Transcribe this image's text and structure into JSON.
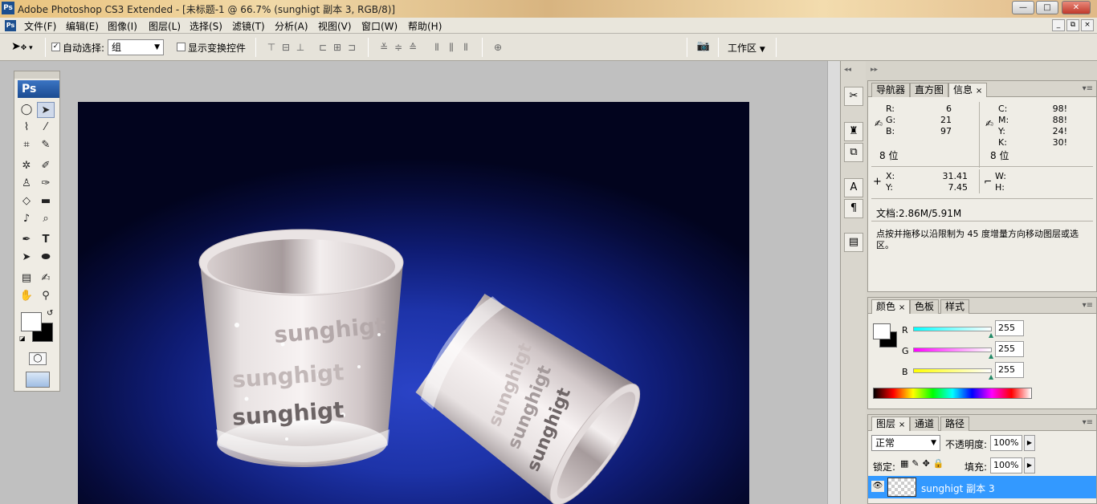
{
  "window": {
    "icon": "Ps",
    "title": "Adobe Photoshop CS3 Extended - [未标题-1 @ 66.7% (sunghigt 副本 3, RGB/8)]",
    "controls": {
      "minimize": "—",
      "maximize": "□",
      "close": "✕"
    }
  },
  "menubar": {
    "icon": "Ps",
    "items": [
      "文件(F)",
      "编辑(E)",
      "图像(I)",
      "图层(L)",
      "选择(S)",
      "滤镜(T)",
      "分析(A)",
      "视图(V)",
      "窗口(W)",
      "帮助(H)"
    ],
    "doc_controls": {
      "minimize": "_",
      "restore": "⧉",
      "close": "×"
    }
  },
  "options": {
    "auto_select_label": "自动选择:",
    "auto_select_checked": true,
    "auto_select_value": "组",
    "show_transform_label": "显示变换控件",
    "show_transform_checked": false,
    "workspace_label": "工作区",
    "align_icons": [
      "align-top-icon",
      "align-vcenter-icon",
      "align-bottom-icon",
      "align-left-icon",
      "align-hcenter-icon",
      "align-right-icon",
      "distribute-top-icon",
      "distribute-vcenter-icon",
      "distribute-bottom-icon",
      "distribute-left-icon",
      "distribute-hcenter-icon",
      "distribute-right-icon",
      "auto-align-icon"
    ]
  },
  "toolbox": {
    "logo": "Ps",
    "tools": [
      "marquee-tool",
      "move-tool",
      "lasso-tool",
      "magic-wand-tool",
      "crop-tool",
      "slice-tool",
      "healing-brush-tool",
      "brush-tool",
      "clone-stamp-tool",
      "history-brush-tool",
      "eraser-tool",
      "gradient-tool",
      "blur-tool",
      "dodge-tool",
      "pen-tool",
      "type-tool",
      "path-selection-tool",
      "ellipse-tool",
      "notes-tool",
      "eyedropper-tool",
      "hand-tool",
      "zoom-tool"
    ],
    "foreground_color": "#ffffff",
    "background_color": "#000000"
  },
  "canvas": {
    "watermark_texts": [
      "sunghigt",
      "sunghigt",
      "sunghigt"
    ],
    "tilted_cup_texts": [
      "sunghigt",
      "sunghigt",
      "sunghigt"
    ],
    "background_color": "#1d33a8"
  },
  "info_panel": {
    "tabs": [
      "导航器",
      "直方图",
      "信息"
    ],
    "active_tab": "信息",
    "rgb": {
      "R_label": "R:",
      "R": "6",
      "G_label": "G:",
      "G": "21",
      "B_label": "B:",
      "B": "97"
    },
    "cmyk": {
      "C_label": "C:",
      "C": "98!",
      "M_label": "M:",
      "M": "88!",
      "Y_label": "Y:",
      "Y": "24!",
      "K_label": "K:",
      "K": "30!"
    },
    "bits_left": "8 位",
    "bits_right": "8 位",
    "coords": {
      "X_label": "X:",
      "X": "31.41",
      "Y_label": "Y:",
      "Y": "7.45",
      "W_label": "W:",
      "H_label": "H:"
    },
    "doc_size": "文档:2.86M/5.91M",
    "hint": "点按并拖移以沿限制为 45 度增量方向移动图层或选区。"
  },
  "color_panel": {
    "tabs": [
      "颜色",
      "色板",
      "样式"
    ],
    "active_tab": "颜色",
    "channels": [
      {
        "label": "R",
        "value": "255",
        "color": "#00e0e0"
      },
      {
        "label": "G",
        "value": "255",
        "color": "#e000e0"
      },
      {
        "label": "B",
        "value": "255",
        "color": "#e0e000"
      }
    ]
  },
  "layers_panel": {
    "tabs": [
      "图层",
      "通道",
      "路径"
    ],
    "active_tab": "图层",
    "blend_mode": "正常",
    "opacity_label": "不透明度:",
    "opacity": "100%",
    "lock_label": "锁定:",
    "fill_label": "填充:",
    "fill": "100%",
    "selected_layer": "sunghigt 副本 3"
  },
  "colors": {
    "selection": "#3399ff",
    "panel_bg": "#efede6",
    "titlebar": "#e9c27d"
  }
}
